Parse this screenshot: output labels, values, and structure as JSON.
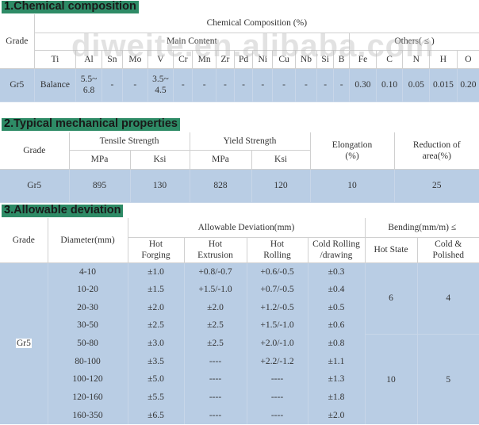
{
  "watermark": "diweite.en.alibaba.com",
  "section1": {
    "number": "1",
    "title": "Chemical composition",
    "headers": {
      "grade": "Grade",
      "chemical_composition": "Chemical Composition (%)",
      "main_content": "Main Content",
      "others": "Others( ≤ )"
    },
    "main_elements": [
      "Ti",
      "Al",
      "Sn",
      "Mo",
      "V",
      "Cr",
      "Mn",
      "Zr",
      "Pd",
      "Ni",
      "Cu",
      "Nb",
      "Si",
      "B"
    ],
    "other_elements": [
      "Fe",
      "C",
      "N",
      "H",
      "O"
    ],
    "row": {
      "grade": "Gr5",
      "main_values": [
        "Balance",
        "5.5~ 6.8",
        "-",
        "-",
        "3.5~ 4.5",
        "-",
        "-",
        "-",
        "-",
        "-",
        "-",
        "-",
        "-",
        "-"
      ],
      "other_values": [
        "0.30",
        "0.10",
        "0.05",
        "0.015",
        "0.20"
      ]
    }
  },
  "section2": {
    "number": "2",
    "title": "Typical mechanical properties",
    "headers": {
      "grade": "Grade",
      "tensile": "Tensile Strength",
      "yield": "Yield Strength",
      "elongation": "Elongation (%)",
      "reduction": "Reduction of area(%)",
      "mpa": "MPa",
      "ksi": "Ksi"
    },
    "row": {
      "grade": "Gr5",
      "tensile_mpa": "895",
      "tensile_ksi": "130",
      "yield_mpa": "828",
      "yield_ksi": "120",
      "elongation": "10",
      "reduction": "25"
    }
  },
  "section3": {
    "number": "3",
    "title": "Allowable deviation",
    "headers": {
      "grade": "Grade",
      "diameter": "Diameter(mm)",
      "allowable": "Allowable Deviation(mm)",
      "bending": "Bending(mm/m) ≤",
      "hot_forging": "Hot Forging",
      "hot_extrusion": "Hot Extrusion",
      "hot_rolling": "Hot Rolling",
      "cold_rolling": "Cold Rolling /drawing",
      "hot_state": "Hot State",
      "cold_polished": "Cold & Polished"
    },
    "grade": "Gr5",
    "rows": [
      {
        "diameter": "4-10",
        "forging": "±1.0",
        "extrusion": "+0.8/-0.7",
        "rolling": "+0.6/-0.5",
        "cold": "±0.3"
      },
      {
        "diameter": "10-20",
        "forging": "±1.5",
        "extrusion": "+1.5/-1.0",
        "rolling": "+0.7/-0.5",
        "cold": "±0.4"
      },
      {
        "diameter": "20-30",
        "forging": "±2.0",
        "extrusion": "±2.0",
        "rolling": "+1.2/-0.5",
        "cold": "±0.5"
      },
      {
        "diameter": "30-50",
        "forging": "±2.5",
        "extrusion": "±2.5",
        "rolling": "+1.5/-1.0",
        "cold": "±0.6"
      },
      {
        "diameter": "50-80",
        "forging": "±3.0",
        "extrusion": "±2.5",
        "rolling": "+2.0/-1.0",
        "cold": "±0.8"
      },
      {
        "diameter": "80-100",
        "forging": "±3.5",
        "extrusion": "----",
        "rolling": "+2.2/-1.2",
        "cold": "±1.1"
      },
      {
        "diameter": "100-120",
        "forging": "±5.0",
        "extrusion": "----",
        "rolling": "----",
        "cold": "±1.3"
      },
      {
        "diameter": "120-160",
        "forging": "±5.5",
        "extrusion": "----",
        "rolling": "----",
        "cold": "±1.8"
      },
      {
        "diameter": "160-350",
        "forging": "±6.5",
        "extrusion": "----",
        "rolling": "----",
        "cold": "±2.0"
      }
    ],
    "bending_groups": [
      {
        "hot_state": "6",
        "cold_polished": "4"
      },
      {
        "hot_state": "10",
        "cold_polished": "5"
      }
    ]
  }
}
